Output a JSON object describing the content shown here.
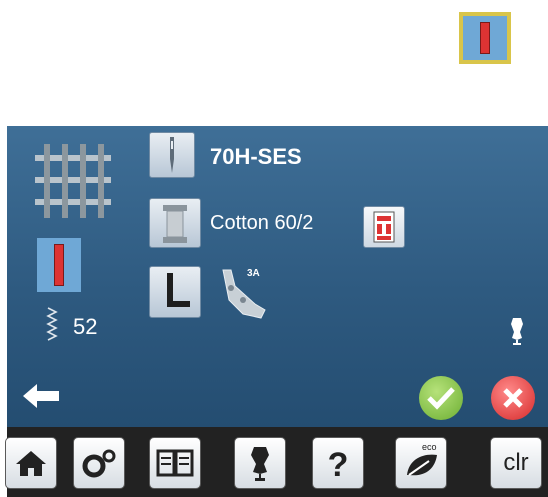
{
  "needle": {
    "label": "70H-SES"
  },
  "thread": {
    "label": "Cotton 60/2"
  },
  "presser_foot": {
    "label": "3A"
  },
  "stitch_length": {
    "value": "52"
  },
  "bottom_bar": {
    "clr_label": "clr",
    "eco_label": "eco"
  },
  "colors": {
    "panel": "#2e5a80",
    "accept": "#7ac143",
    "cancel": "#e23b3b",
    "stitch_red": "#d33333",
    "stitch_blue": "#6fa8d6"
  }
}
